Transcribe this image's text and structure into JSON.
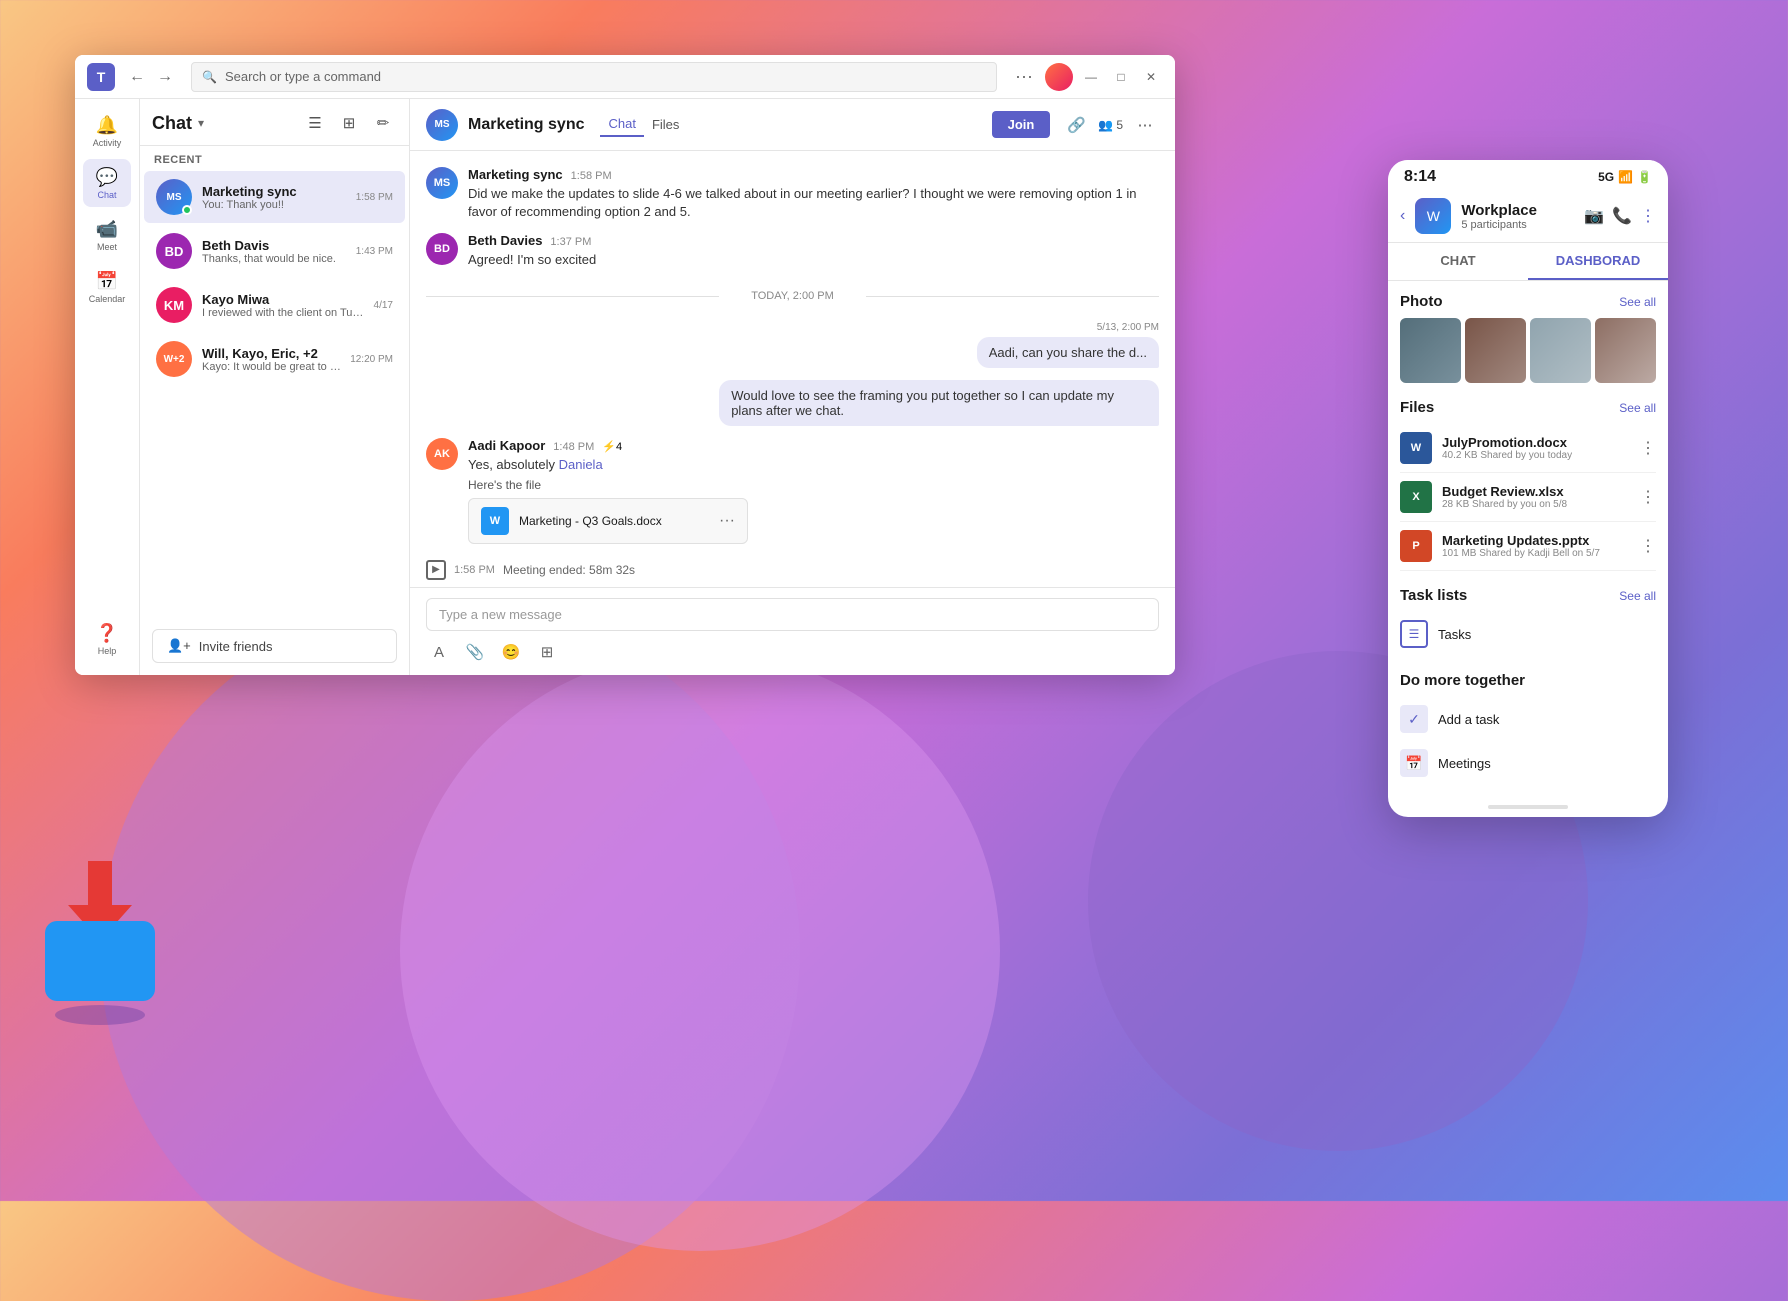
{
  "background": {
    "gradient": "linear-gradient(135deg, #f9c784 0%, #f97c5d 20%, #c96dd8 50%, #7b6fd6 80%, #5b8dee 100%)"
  },
  "titleBar": {
    "search_placeholder": "Search or type a command",
    "dots": "···"
  },
  "sidebar": {
    "items": [
      {
        "icon": "🔔",
        "label": "Activity",
        "active": false
      },
      {
        "icon": "💬",
        "label": "Chat",
        "active": true
      },
      {
        "icon": "📹",
        "label": "Meet",
        "active": false
      },
      {
        "icon": "📅",
        "label": "Calendar",
        "active": false
      }
    ],
    "help_label": "Help"
  },
  "chatList": {
    "title": "Chat",
    "recent_label": "Recent",
    "items": [
      {
        "name": "Marketing sync",
        "preview": "You: Thank you!!",
        "time": "1:58 PM",
        "type": "ms",
        "active": true
      },
      {
        "name": "Beth Davis",
        "preview": "Thanks, that would be nice.",
        "time": "1:43 PM",
        "type": "bd",
        "active": false
      },
      {
        "name": "Kayo Miwa",
        "preview": "I reviewed with the client on Tuesday...",
        "time": "4/17",
        "type": "km",
        "active": false
      },
      {
        "name": "Will, Kayo, Eric, +2",
        "preview": "Kayo: It would be great to sync with...",
        "time": "12:20 PM",
        "type": "group",
        "active": false
      }
    ],
    "invite_label": "Invite friends"
  },
  "chatMain": {
    "title": "Marketing sync",
    "tab_chat": "Chat",
    "tab_files": "Files",
    "join_label": "Join",
    "participants_count": "5",
    "messages": [
      {
        "sender": "Marketing sync",
        "sender_type": "ms",
        "time": "1:58 PM",
        "text": "Did we make the updates to slide 4-6 we talked about in our meeting earlier? I thought we were removing option 1 in favor of recommending option 2 and 5.",
        "direction": "left"
      },
      {
        "sender": "Beth Davies",
        "sender_type": "bd",
        "time": "1:37 PM",
        "text": "Agreed! I'm so excited",
        "direction": "left"
      },
      {
        "date_divider": "TODAY, 2:00 PM"
      },
      {
        "sender_type": "right",
        "time": "5/13, 2:00 PM",
        "text": "Aadi, can you share the d...",
        "direction": "right"
      },
      {
        "sender_type": "right",
        "text": "Would love to see the framing you put together so I can update my plans after we chat.",
        "direction": "right"
      },
      {
        "sender": "Aadi Kapoor",
        "sender_type": "ak",
        "time": "1:48 PM",
        "text": "Yes, absolutely Daniela",
        "mention": "Daniela",
        "reaction": "⚡4",
        "direction": "left",
        "file": {
          "label": "Here's the file",
          "name": "Marketing - Q3 Goals.docx",
          "type": "word"
        }
      }
    ],
    "meeting_ended": "Meeting ended: 58m 32s",
    "input_placeholder": "Type a new message"
  },
  "mobilePanel": {
    "time": "8:14",
    "status": "5G",
    "group_name": "Workplace",
    "participants": "5 participants",
    "tab_chat": "CHAT",
    "tab_dashboard": "DASHBORAD",
    "photo_section": "Photo",
    "see_all": "See all",
    "files_section": "Files",
    "files_see_all": "See all",
    "files": [
      {
        "name": "JulyPromotion.docx",
        "meta": "40.2 KB Shared by you today",
        "type": "word"
      },
      {
        "name": "Budget Review.xlsx",
        "meta": "28 KB Shared by you on 5/8",
        "type": "excel"
      },
      {
        "name": "Marketing Updates.pptx",
        "meta": "101 MB Shared by Kadji Bell on 5/7",
        "type": "ppt"
      }
    ],
    "task_section": "Task lists",
    "task_see_all": "See all",
    "tasks": [
      {
        "name": "Tasks"
      }
    ],
    "more_section": "Do more together",
    "more_items": [
      {
        "label": "Add a task",
        "icon": "✓"
      },
      {
        "label": "Meetings",
        "icon": "📅"
      }
    ]
  }
}
